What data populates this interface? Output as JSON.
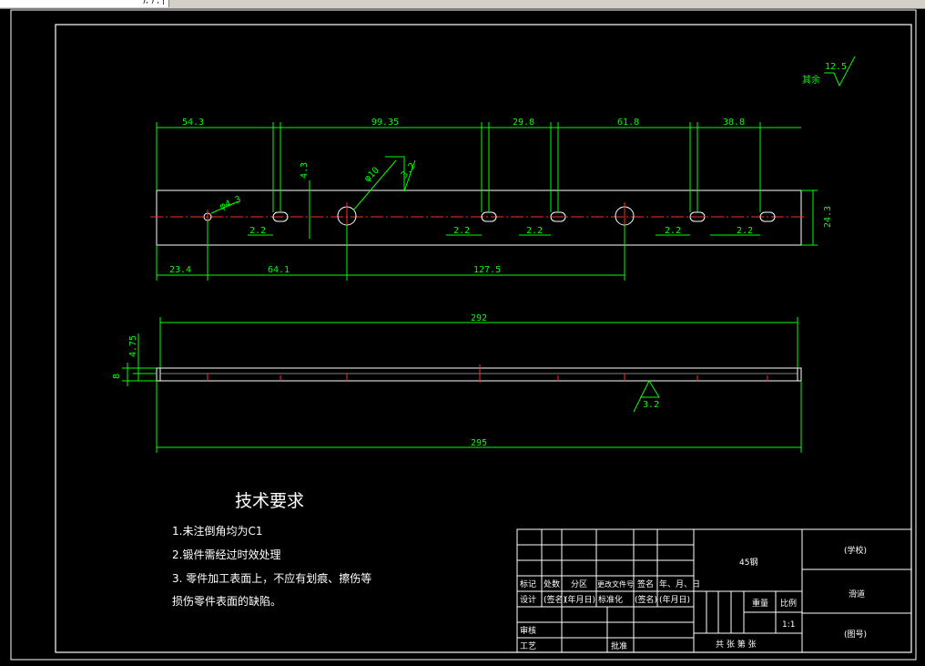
{
  "toolbar": {
    "fragment": "), ) , |"
  },
  "roughness": {
    "other_label": "其余",
    "value": "12.5"
  },
  "top_view_dims": {
    "spacing": [
      "54.3",
      "99.35",
      "29.8",
      "61.8",
      "38.8"
    ],
    "hole_offset": "4.3",
    "hole_dia": "φ10",
    "hole_small": "φ4.3",
    "surface": "3.2",
    "width": "24.3",
    "slot_w": [
      "2.2",
      "2.2",
      "2.2",
      "2.2",
      "2.2"
    ],
    "bottom": [
      "23.4",
      "64.1",
      "127.5"
    ]
  },
  "side_view_dims": {
    "inner_length": "292",
    "outer_length": "295",
    "thickness": "8",
    "sub_thickness": "4.75",
    "surface": "3.2"
  },
  "tech_req": {
    "title": "技术要求",
    "items": [
      "1.未注倒角均为C1",
      "2.锻件需经过时效处理",
      "3. 零件加工表面上，不应有划痕、擦伤等",
      "损伤零件表面的缺陷。"
    ]
  },
  "title_block": {
    "material": "45钢",
    "school": "(学校)",
    "part_name": "滑道",
    "drawing_no": "(图号)",
    "scale_label": "比例",
    "weight_label": "重量",
    "scale": "1:1",
    "sheets": "共  张  第  张",
    "row1": [
      "标记",
      "处数",
      "分区",
      "更改文件号",
      "签名",
      "年、月、日"
    ],
    "row2": [
      "设计",
      "(签名)",
      "(年月日)",
      "标准化",
      "(签名)",
      "(年月日)"
    ],
    "review": "审核",
    "process": "工艺",
    "approve": "批准"
  }
}
